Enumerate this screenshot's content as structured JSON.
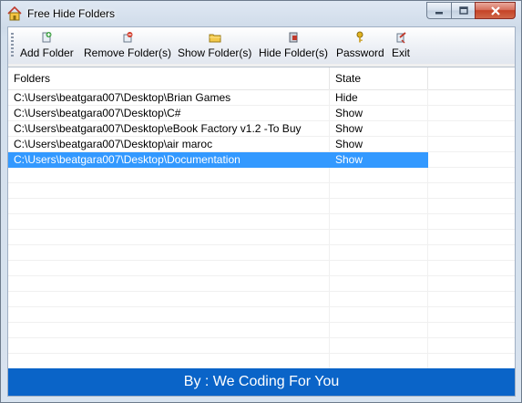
{
  "window": {
    "title": "Free Hide Folders",
    "accent_color": "#0a64c8",
    "selection_color": "#3399ff"
  },
  "toolbar": {
    "items": [
      {
        "label": "Add Folder",
        "icon": "add-folder-icon"
      },
      {
        "label": "Remove Folder(s)",
        "icon": "remove-folder-icon"
      },
      {
        "label": "Show Folder(s)",
        "icon": "show-folder-icon"
      },
      {
        "label": "Hide Folder(s)",
        "icon": "hide-folder-icon"
      },
      {
        "label": "Password",
        "icon": "key-icon"
      },
      {
        "label": "Exit",
        "icon": "exit-icon"
      }
    ]
  },
  "list": {
    "columns": [
      "Folders",
      "State"
    ],
    "rows": [
      {
        "folder": "C:\\Users\\beatgara007\\Desktop\\Brian Games",
        "state": "Hide",
        "selected": false
      },
      {
        "folder": "C:\\Users\\beatgara007\\Desktop\\C#",
        "state": "Show",
        "selected": false
      },
      {
        "folder": "C:\\Users\\beatgara007\\Desktop\\eBook Factory v1.2 -To Buy",
        "state": "Show",
        "selected": false
      },
      {
        "folder": "C:\\Users\\beatgara007\\Desktop\\air maroc",
        "state": "Show",
        "selected": false
      },
      {
        "folder": "C:\\Users\\beatgara007\\Desktop\\Documentation",
        "state": "Show",
        "selected": true
      }
    ]
  },
  "footer": {
    "text": "By : We Coding For You"
  }
}
